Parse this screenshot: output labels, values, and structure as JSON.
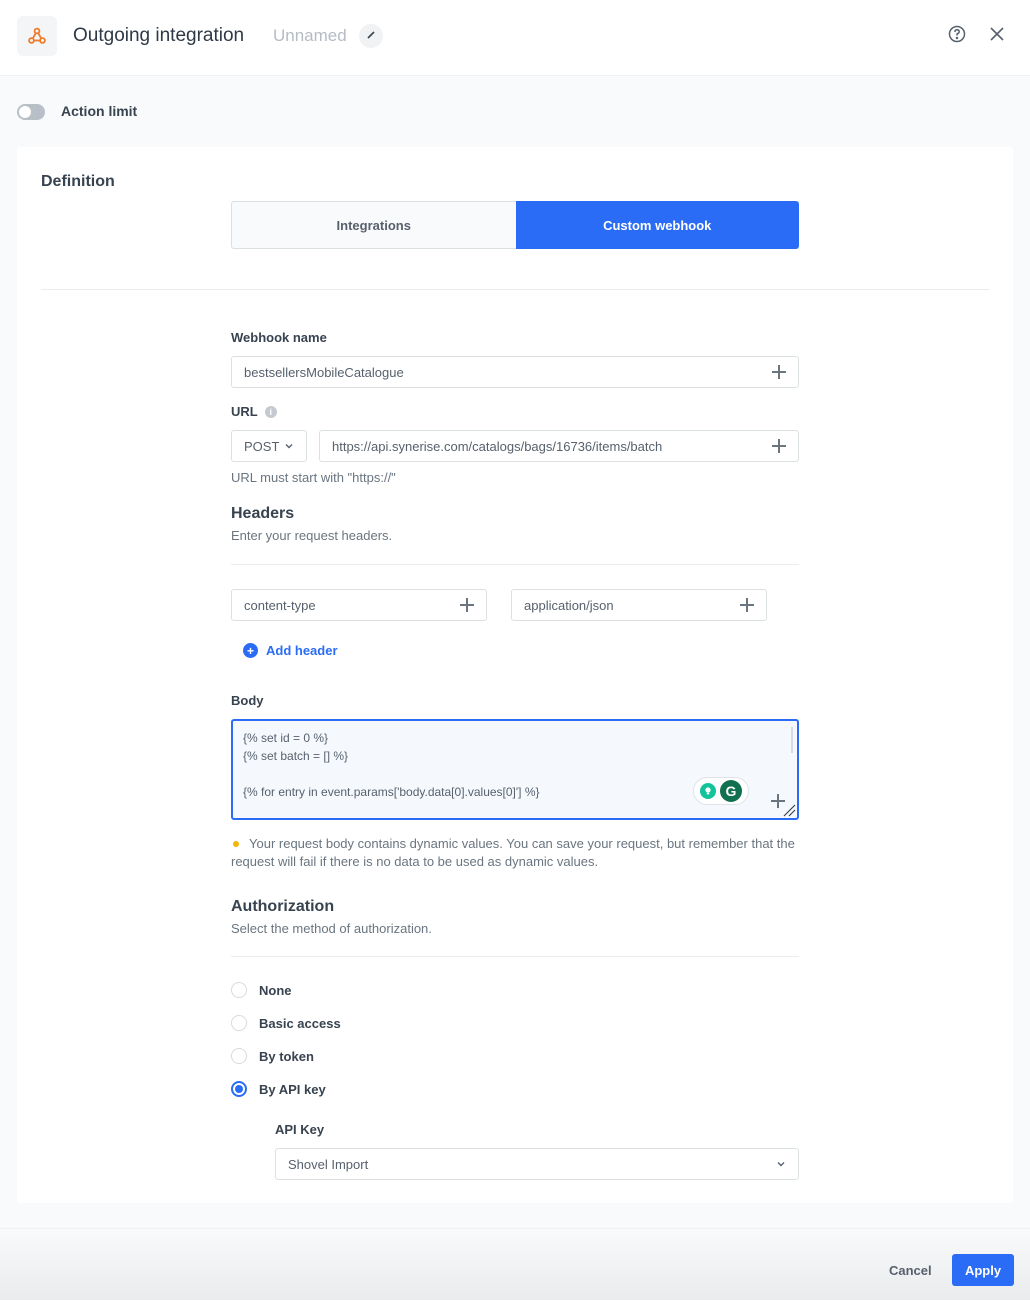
{
  "header": {
    "title": "Outgoing integration",
    "subtitle": "Unnamed",
    "app_icon": "webhook-icon",
    "edit_icon": "pencil-icon",
    "help_icon": "help-circle-icon",
    "close_icon": "close-icon"
  },
  "action_limit": {
    "label": "Action limit",
    "enabled": false
  },
  "definition": {
    "title": "Definition",
    "tabs": [
      {
        "label": "Integrations",
        "active": false
      },
      {
        "label": "Custom webhook",
        "active": true
      }
    ]
  },
  "webhook": {
    "name_label": "Webhook name",
    "name_value": "bestsellersMobileCatalogue",
    "url_label": "URL",
    "method": "POST",
    "url_value": "https://api.synerise.com/catalogs/bags/16736/items/batch",
    "url_hint": "URL must start with \"https://\""
  },
  "headers": {
    "title": "Headers",
    "description": "Enter your request headers.",
    "rows": [
      {
        "key": "content-type",
        "value": "application/json"
      }
    ],
    "add_label": "Add header"
  },
  "body": {
    "label": "Body",
    "lines": [
      "{% set id = 0 %}",
      "{% set batch = [] %}",
      "",
      "{% for entry in event.params['body.data[0].values[0]'] %}"
    ],
    "warning": "Your request body contains dynamic values. You can save your request, but remember that the request will fail if there is no data to be used as dynamic values."
  },
  "authorization": {
    "title": "Authorization",
    "description": "Select the method of authorization.",
    "options": [
      {
        "label": "None",
        "checked": false
      },
      {
        "label": "Basic access",
        "checked": false
      },
      {
        "label": "By token",
        "checked": false
      },
      {
        "label": "By API key",
        "checked": true
      }
    ],
    "api_key_label": "API Key",
    "api_key_value": "Shovel Import"
  },
  "footer": {
    "cancel_label": "Cancel",
    "apply_label": "Apply"
  },
  "colors": {
    "accent": "#2b6cf6",
    "icon_orange": "#f07b2a",
    "warning": "#f2b705"
  }
}
